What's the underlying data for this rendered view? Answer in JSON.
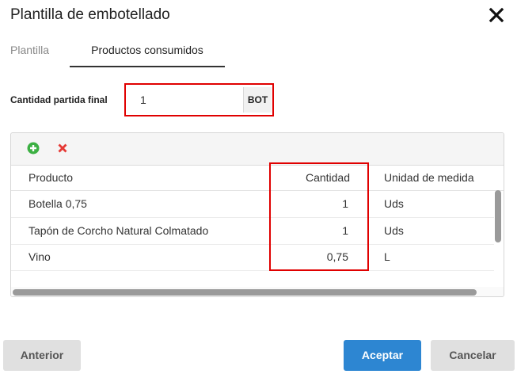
{
  "dialog": {
    "title": "Plantilla de embotellado",
    "close_icon": "close-icon"
  },
  "tabs": [
    {
      "label": "Plantilla",
      "active": false
    },
    {
      "label": "Productos consumidos",
      "active": true
    }
  ],
  "quantity": {
    "label": "Cantidad partida final",
    "value": "1",
    "unit": "BOT"
  },
  "toolbar": {
    "add_icon": "plus-circle-icon",
    "delete_icon": "delete-x-icon"
  },
  "table": {
    "columns": [
      "Producto",
      "Cantidad",
      "Unidad de medida"
    ],
    "rows": [
      {
        "producto": "Botella 0,75",
        "cantidad": "1",
        "unidad": "Uds"
      },
      {
        "producto": "Tapón de Corcho  Natural Colmatado",
        "cantidad": "1",
        "unidad": "Uds"
      },
      {
        "producto": "Vino",
        "cantidad": "0,75",
        "unidad": "L"
      }
    ]
  },
  "buttons": {
    "previous": "Anterior",
    "accept": "Aceptar",
    "cancel": "Cancelar"
  },
  "colors": {
    "highlight": "#e00000",
    "accept_button": "#2d86d2",
    "add_icon": "#3cb043",
    "delete_icon": "#e53935"
  }
}
